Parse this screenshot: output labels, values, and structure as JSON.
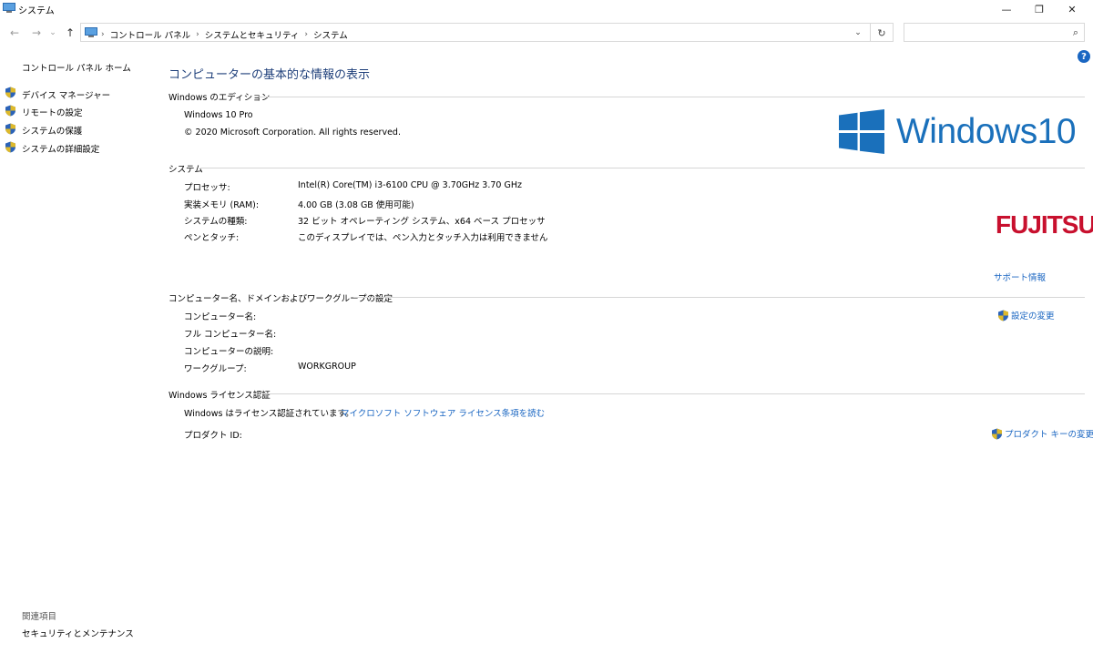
{
  "window": {
    "title": "システム",
    "minimize_glyph": "—",
    "maximize_glyph": "❐",
    "close_glyph": "✕"
  },
  "nav": {
    "back_glyph": "←",
    "forward_glyph": "→",
    "dropdown_glyph": "⌄",
    "up_glyph": "↑",
    "breadcrumb": [
      "コントロール パネル",
      "システムとセキュリティ",
      "システム"
    ],
    "breadcrumb_sep": "›",
    "address_dropdown_glyph": "⌄",
    "refresh_glyph": "↻",
    "search_placeholder": "",
    "search_glyph": "⌕"
  },
  "sidebar": {
    "home": "コントロール パネル ホーム",
    "items": [
      {
        "label": "デバイス マネージャー",
        "icon": "shield-icon"
      },
      {
        "label": "リモートの設定",
        "icon": "shield-icon"
      },
      {
        "label": "システムの保護",
        "icon": "shield-icon"
      },
      {
        "label": "システムの詳細設定",
        "icon": "shield-icon"
      }
    ],
    "related_heading": "関連項目",
    "related_link": "セキュリティとメンテナンス"
  },
  "main": {
    "help_glyph": "?",
    "title": "コンピューターの基本的な情報の表示",
    "edition": {
      "heading": "Windows のエディション",
      "name": "Windows 10 Pro",
      "copyright": "© 2020 Microsoft Corporation. All rights reserved.",
      "logo_text": "Windows10"
    },
    "system": {
      "heading": "システム",
      "rows": [
        {
          "label": "プロセッサ:",
          "value": "Intel(R) Core(TM) i3-6100 CPU @ 3.70GHz   3.70 GHz"
        },
        {
          "label": "実装メモリ (RAM):",
          "value": "4.00 GB (3.08 GB 使用可能)"
        },
        {
          "label": "システムの種類:",
          "value": "32 ビット オペレーティング システム、x64 ベース プロセッサ"
        },
        {
          "label": "ペンとタッチ:",
          "value": "このディスプレイでは、ペン入力とタッチ入力は利用できません"
        }
      ],
      "oem_logo": "FUJITSU",
      "support_link": "サポート情報"
    },
    "computer": {
      "heading": "コンピューター名、ドメインおよびワークグループの設定",
      "rows": [
        {
          "label": "コンピューター名:",
          "value": ""
        },
        {
          "label": "フル コンピューター名:",
          "value": ""
        },
        {
          "label": "コンピューターの説明:",
          "value": ""
        },
        {
          "label": "ワークグループ:",
          "value": "WORKGROUP"
        }
      ],
      "change_settings_link": "設定の変更"
    },
    "license": {
      "heading": "Windows ライセンス認証",
      "status": "Windows はライセンス認証されています。",
      "terms_link": "マイクロソフト ソフトウェア ライセンス条項を読む",
      "product_id_label": "プロダクト ID:",
      "change_key_link": "プロダクト キーの変更"
    }
  },
  "colors": {
    "link": "#1a66c2",
    "title": "#1e3f7a",
    "windows_logo": "#1a70bb",
    "fujitsu_red": "#c8102e",
    "shield_blue": "#2b63b8",
    "shield_yellow": "#f2c21b"
  }
}
